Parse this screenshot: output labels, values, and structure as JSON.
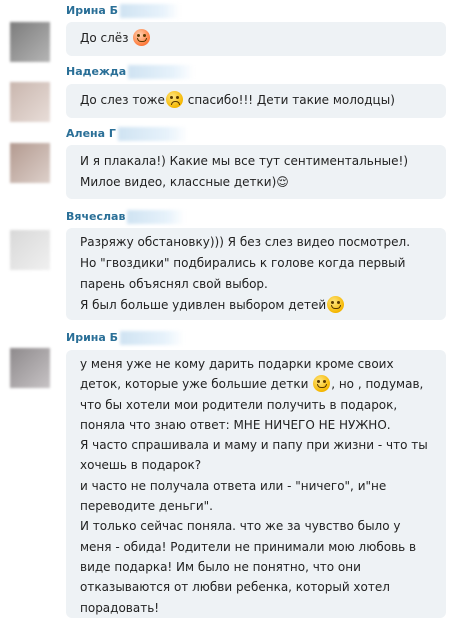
{
  "messages": [
    {
      "author": "Ирина Б",
      "lines": [
        [
          {
            "t": "text",
            "v": "До слёз "
          },
          {
            "t": "emoji",
            "icon": "kiss-emoji-icon"
          }
        ]
      ]
    },
    {
      "author": "Надежда",
      "lines": [
        [
          {
            "t": "text",
            "v": "До слез тоже"
          },
          {
            "t": "emoji",
            "icon": "sad-emoji-icon"
          },
          {
            "t": "text",
            "v": " спасибо!!! Дети такие молодцы)"
          }
        ]
      ]
    },
    {
      "author": "Алена Г",
      "lines": [
        [
          {
            "t": "text",
            "v": "И я плакала!) Какие мы все тут сентиментальные!)"
          }
        ],
        [
          {
            "t": "text",
            "v": "Милое видео, классные детки)😌"
          }
        ]
      ]
    },
    {
      "author": "Вячеслав",
      "lines": [
        [
          {
            "t": "text",
            "v": "Разряжу обстановку))) Я без слез видео посмотрел."
          }
        ],
        [
          {
            "t": "text",
            "v": "Но \"гвоздики\" подбирались к голове когда первый"
          }
        ],
        [
          {
            "t": "text",
            "v": "парень объяснял свой выбор."
          }
        ],
        [
          {
            "t": "text",
            "v": "Я был больше удивлен выбором детей"
          },
          {
            "t": "emoji",
            "icon": "smile-emoji-icon"
          }
        ]
      ]
    },
    {
      "author": "Ирина Б",
      "lines": [
        [
          {
            "t": "text",
            "v": " у меня уже не кому дарить подарки кроме своих"
          }
        ],
        [
          {
            "t": "text",
            "v": "деток, которые уже большие детки "
          },
          {
            "t": "emoji",
            "icon": "smile-emoji-icon"
          },
          {
            "t": "text",
            "v": ", но , подумав,"
          }
        ],
        [
          {
            "t": "text",
            "v": "что бы хотели мои родители получить в подарок,"
          }
        ],
        [
          {
            "t": "text",
            "v": "поняла что знаю ответ: МНЕ НИЧЕГО НЕ НУЖНО."
          }
        ],
        [
          {
            "t": "text",
            "v": "Я часто спрашивала и маму и папу при жизни - что ты"
          }
        ],
        [
          {
            "t": "text",
            "v": "хочешь в подарок?"
          }
        ],
        [
          {
            "t": "text",
            "v": "и часто не получала ответа или - \"ничего\", и\"не"
          }
        ],
        [
          {
            "t": "text",
            "v": "переводите деньги\"."
          }
        ],
        [
          {
            "t": "text",
            "v": "И только сейчас поняла. что же за чувство было у"
          }
        ],
        [
          {
            "t": "text",
            "v": "меня - обида! Родители не принимали мою любовь в"
          }
        ],
        [
          {
            "t": "text",
            "v": "виде подарка! Им было не понятно, что они"
          }
        ],
        [
          {
            "t": "text",
            "v": "отказываются от любви ребенка, который хотел"
          }
        ],
        [
          {
            "t": "text",
            "v": "порадовать!"
          }
        ]
      ]
    }
  ]
}
